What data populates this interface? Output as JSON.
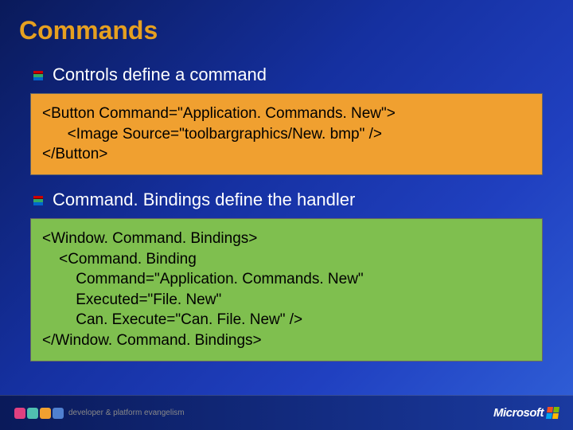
{
  "title": "Commands",
  "bullet1": "Controls define a command",
  "code1": "<Button Command=\"Application. Commands. New\">\n      <Image Source=\"toolbargraphics/New. bmp\" />\n</Button>",
  "bullet2": "Command. Bindings define the handler",
  "code2": "<Window. Command. Bindings>\n    <Command. Binding\n        Command=\"Application. Commands. New\"\n        Executed=\"File. New\"\n        Can. Execute=\"Can. File. New\" />\n</Window. Command. Bindings>",
  "footer": {
    "tagline": "developer & platform evangelism",
    "brand": "Microsoft"
  },
  "colors": {
    "logo1": "#e04080",
    "logo2": "#50c0b0",
    "logo3": "#f0a030",
    "logo4": "#5080d0",
    "ms_red": "#f25022",
    "ms_green": "#7fba00",
    "ms_blue": "#00a4ef",
    "ms_yellow": "#ffb900"
  }
}
